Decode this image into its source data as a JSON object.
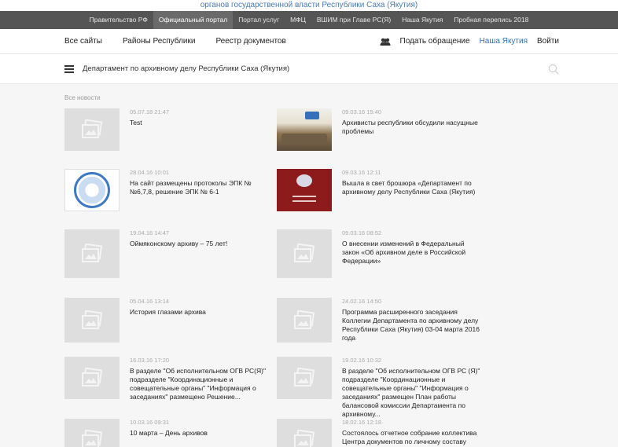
{
  "top_strip": "органов государственной власти Республики Саха (Якутия)",
  "gov_links": [
    {
      "label": "Правительство РФ",
      "active": false
    },
    {
      "label": "Официальный портал",
      "active": true
    },
    {
      "label": "Портал услуг",
      "active": false
    },
    {
      "label": "МФЦ",
      "active": false
    },
    {
      "label": "ВШИМ при Главе РС(Я)",
      "active": false
    },
    {
      "label": "Наша Якутия",
      "active": false
    },
    {
      "label": "Пробная перепись 2018",
      "active": false
    }
  ],
  "main_nav": {
    "left": [
      "Все сайты",
      "Районы Республики",
      "Реестр документов"
    ],
    "appeal": "Подать обращение",
    "region": "Наша Якутия",
    "login": "Войти"
  },
  "dept": {
    "title": "Департамент по архивному делу Республики Саха (Якутия)"
  },
  "news": {
    "section_label": "Все новости",
    "items": [
      {
        "date": "05.07.18 21:47",
        "title": "Test",
        "thumb": "placeholder"
      },
      {
        "date": "09.03.16 15:40",
        "title": "Архивисты республики обсудили насущные проблемы",
        "thumb": "photo-meeting"
      },
      {
        "date": "28.04.16 10:01",
        "title": "На сайт размещены протоколы ЭПК № №6,7,8, решение ЭПК № 6-1",
        "thumb": "photo-emblem"
      },
      {
        "date": "09.03.16 12:11",
        "title": "Вышла в свет брошюра «Департамент по архивному делу Республики Саха (Якутия)",
        "thumb": "photo-brochure"
      },
      {
        "date": "19.04.16 14:47",
        "title": "Оймяконскому архиву – 75 лет!",
        "thumb": "placeholder"
      },
      {
        "date": "09.03.16 08:52",
        "title": "О внесении изменений в Федеральный закон «Об архивном деле в Российской Федерации»",
        "thumb": "placeholder"
      },
      {
        "date": "05.04.16 13:14",
        "title": "История глазами архива",
        "thumb": "placeholder"
      },
      {
        "date": "24.02.16 14:50",
        "title": "Программа расширенного заседания Коллегии Департамента по архивному делу Республики Саха (Якутия) 03-04 марта 2016 года",
        "thumb": "placeholder"
      },
      {
        "date": "16.03.16 17:20",
        "title": "В разделе \"Об исполнительном ОГВ РС(Я)\" подразделе \"Координационные и совещательные органы\" \"Информация о заседаниях\" размещено Решение...",
        "thumb": "placeholder"
      },
      {
        "date": "19.02.16 10:32",
        "title": "В разделе \"Об исполнительном ОГВ РС (Я)\" подразделе \"Координационные и совещательные органы\" \"Информация о заседаниях\" размещен План работы балансовой комиссии Департамента по архивному...",
        "thumb": "placeholder"
      },
      {
        "date": "10.03.16 09:31",
        "title": "10 марта – День архивов",
        "thumb": "placeholder"
      },
      {
        "date": "18.02.16 12:18",
        "title": "Состоялось отчетное собрание коллектива Центра документов по личному составу РС(Я)",
        "thumb": "placeholder"
      }
    ]
  },
  "colors": {
    "gov_bar": "#555555",
    "accent_link": "#2d73b9",
    "thumb_placeholder": "#dedede"
  }
}
